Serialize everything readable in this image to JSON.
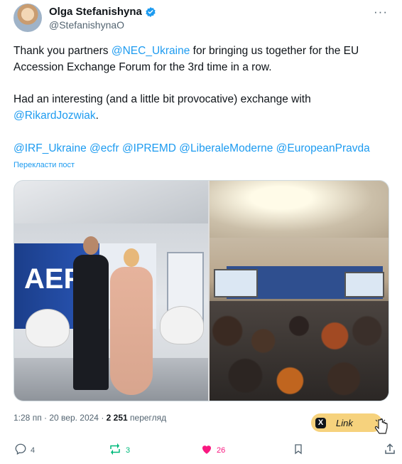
{
  "author": {
    "name": "Olga Stefanishyna",
    "handle": "@StefanishynaO"
  },
  "menu": {
    "more_label": "···"
  },
  "tweet": {
    "p1_before": "Thank you partners ",
    "p1_mention": "@NEC_Ukraine",
    "p1_after": " for bringing us together for the EU Accession Exchange Forum for the 3rd time in a row.",
    "p2_text": "Had an interesting (and a little bit provocative) exchange with ",
    "p2_mention": "@RikardJozwiak",
    "p2_end": ".",
    "tags": [
      "@IRF_Ukraine",
      "@ecfr",
      "@IPREMD",
      "@LiberaleModerne",
      "@EuropeanPravda"
    ],
    "translate_label": "Перекласти пост"
  },
  "media": {
    "left_banner_text": "AEF"
  },
  "meta": {
    "time": "1:28 пп · 20 вер. 2024 · ",
    "views_count": "2 251",
    "views_label": " перегляд"
  },
  "link_pill": {
    "x_label": "X",
    "label": "Link"
  },
  "actions": {
    "replies": "4",
    "reposts": "3",
    "likes": "26"
  },
  "colors": {
    "accent": "#1d9bf0",
    "like": "#f91880",
    "repost": "#00ba7c",
    "pill": "#f6d27d"
  }
}
